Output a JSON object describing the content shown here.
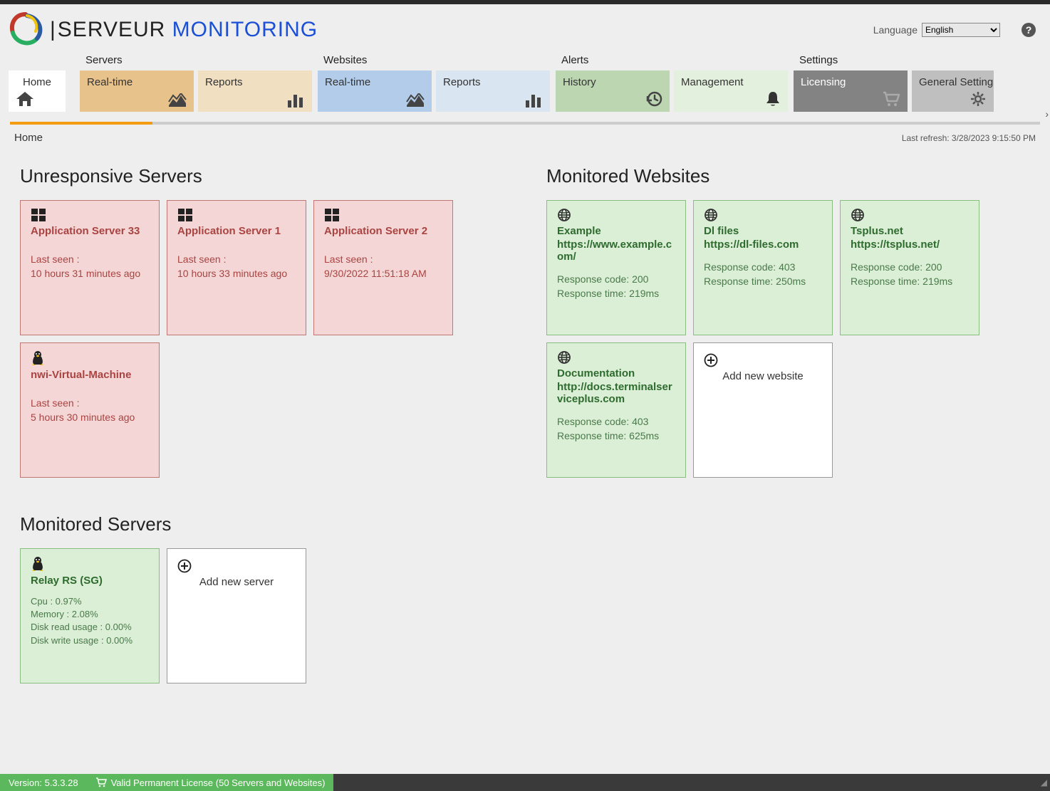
{
  "header": {
    "logo_serveur": "SERVEUR ",
    "logo_monitoring": "MONITORING",
    "language_label": "Language",
    "language_value": "English"
  },
  "nav": {
    "home": "Home",
    "servers_label": "Servers",
    "servers_realtime": "Real-time",
    "servers_reports": "Reports",
    "websites_label": "Websites",
    "websites_realtime": "Real-time",
    "websites_reports": "Reports",
    "alerts_label": "Alerts",
    "alerts_history": "History",
    "alerts_management": "Management",
    "settings_label": "Settings",
    "settings_licensing": "Licensing",
    "settings_general": "General Settings"
  },
  "breadcrumb": "Home",
  "last_refresh": "Last refresh: 3/28/2023 9:15:50 PM",
  "sections": {
    "unresponsive": "Unresponsive Servers",
    "monitored_websites": "Monitored Websites",
    "monitored_servers": "Monitored Servers"
  },
  "unresponsive": [
    {
      "os": "windows",
      "name": "Application Server 33",
      "lastseen_label": "Last seen :",
      "lastseen": "10 hours 31 minutes ago"
    },
    {
      "os": "windows",
      "name": "Application Server 1",
      "lastseen_label": "Last seen :",
      "lastseen": "10 hours 33 minutes ago"
    },
    {
      "os": "windows",
      "name": "Application Server 2",
      "lastseen_label": "Last seen :",
      "lastseen": "9/30/2022 11:51:18 AM"
    },
    {
      "os": "linux",
      "name": "nwi-Virtual-Machine",
      "lastseen_label": "Last seen :",
      "lastseen": "5 hours 30 minutes ago"
    }
  ],
  "websites": [
    {
      "name": "Example",
      "url": "https://www.example.com/",
      "code": "Response code: 200",
      "time": "Response time: 219ms"
    },
    {
      "name": "Dl files",
      "url": "https://dl-files.com",
      "code": "Response code: 403",
      "time": "Response time: 250ms"
    },
    {
      "name": "Tsplus.net",
      "url": "https://tsplus.net/",
      "code": "Response code: 200",
      "time": "Response time: 219ms"
    },
    {
      "name": "Documentation",
      "url": "http://docs.terminalserviceplus.com",
      "code": "Response code: 403",
      "time": "Response time: 625ms"
    }
  ],
  "add_website": "Add new website",
  "monitored_servers": [
    {
      "os": "linux",
      "name": "Relay RS (SG)",
      "cpu": "Cpu : 0.97%",
      "mem": "Memory : 2.08%",
      "diskr": "Disk read usage : 0.00%",
      "diskw": "Disk write usage : 0.00%"
    }
  ],
  "add_server": "Add new server",
  "footer": {
    "version": "Version: 5.3.3.28",
    "license": "Valid Permanent License (50 Servers and Websites)"
  }
}
